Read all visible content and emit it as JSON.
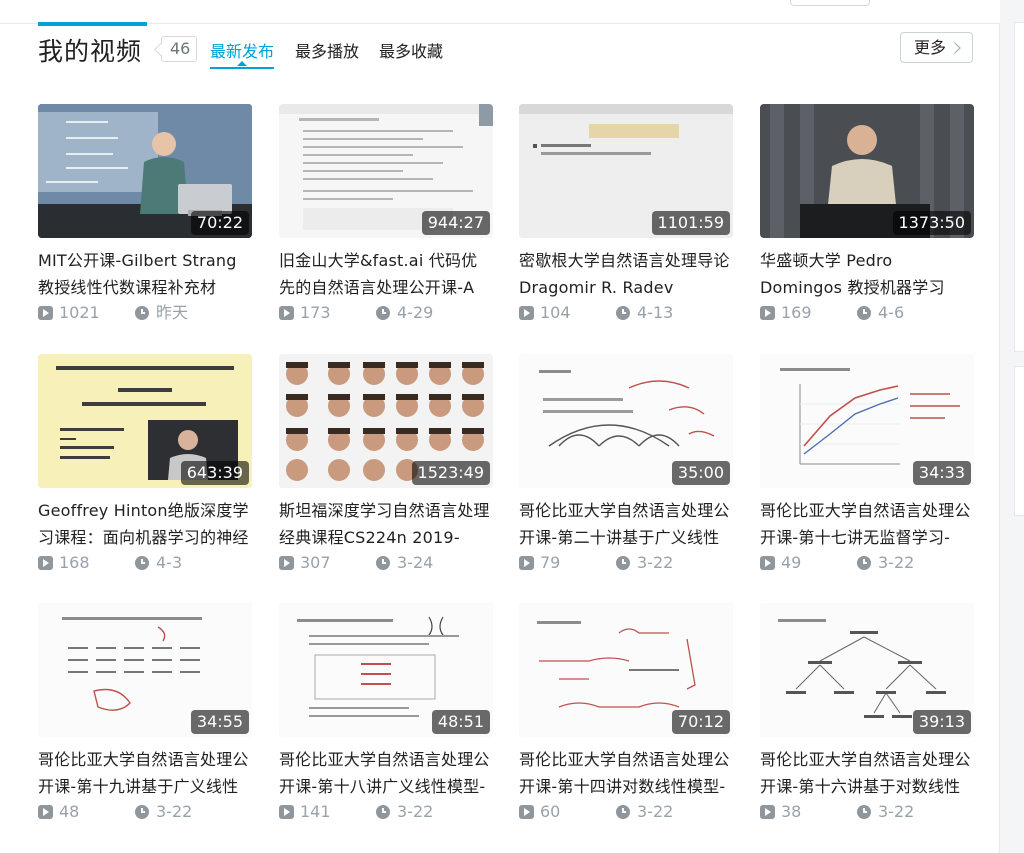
{
  "header": {
    "title": "我的视频",
    "count": "46",
    "tabs": [
      {
        "label": "最新发布",
        "active": true
      },
      {
        "label": "最多播放",
        "active": false
      },
      {
        "label": "最多收藏",
        "active": false
      }
    ],
    "more_label": "更多"
  },
  "colors": {
    "accent": "#00a1d6",
    "text": "#212121",
    "meta": "#99a2aa"
  },
  "videos": [
    {
      "title": "MIT公开课-Gilbert Strang教授线性代数课程补充材",
      "duration": "70:22",
      "plays": "1021",
      "date": "昨天",
      "thumb": "lecture-room-speaker"
    },
    {
      "title": "旧金山大学&fast.ai 代码优先的自然语言处理公开课-A",
      "duration": "944:27",
      "plays": "173",
      "date": "4-29",
      "thumb": "notebook-screen"
    },
    {
      "title": "密歇根大学自然语言处理导论Dragomir R. Radev",
      "duration": "1101:59",
      "plays": "104",
      "date": "4-13",
      "thumb": "slide-introduction"
    },
    {
      "title": "华盛顿大学 Pedro Domingos 教授机器学习",
      "duration": "1373:50",
      "plays": "169",
      "date": "4-6",
      "thumb": "podium-speaker"
    },
    {
      "title": "Geoffrey Hinton绝版深度学习课程：面向机器学习的神经",
      "duration": "643:39",
      "plays": "168",
      "date": "4-3",
      "thumb": "yellow-slide"
    },
    {
      "title": "斯坦福深度学习自然语言处理经典课程CS224n 2019-",
      "duration": "1523:49",
      "plays": "307",
      "date": "3-24",
      "thumb": "instructor-faces"
    },
    {
      "title": "哥伦比亚大学自然语言处理公开课-第二十讲基于广义线性",
      "duration": "35:00",
      "plays": "79",
      "date": "3-22",
      "thumb": "handwritten-arcs"
    },
    {
      "title": "哥伦比亚大学自然语言处理公开课-第十七讲无监督学习-",
      "duration": "34:33",
      "plays": "49",
      "date": "3-22",
      "thumb": "handwritten-plot"
    },
    {
      "title": "哥伦比亚大学自然语言处理公开课-第十九讲基于广义线性",
      "duration": "34:55",
      "plays": "48",
      "date": "3-22",
      "thumb": "handwritten-table"
    },
    {
      "title": "哥伦比亚大学自然语言处理公开课-第十八讲广义线性模型-",
      "duration": "48:51",
      "plays": "141",
      "date": "3-22",
      "thumb": "handwritten-slide"
    },
    {
      "title": "哥伦比亚大学自然语言处理公开课-第十四讲对数线性模型-",
      "duration": "70:12",
      "plays": "60",
      "date": "3-22",
      "thumb": "handwritten-formulas"
    },
    {
      "title": "哥伦比亚大学自然语言处理公开课-第十六讲基于对数线性",
      "duration": "39:13",
      "plays": "38",
      "date": "3-22",
      "thumb": "handwritten-tree"
    }
  ]
}
